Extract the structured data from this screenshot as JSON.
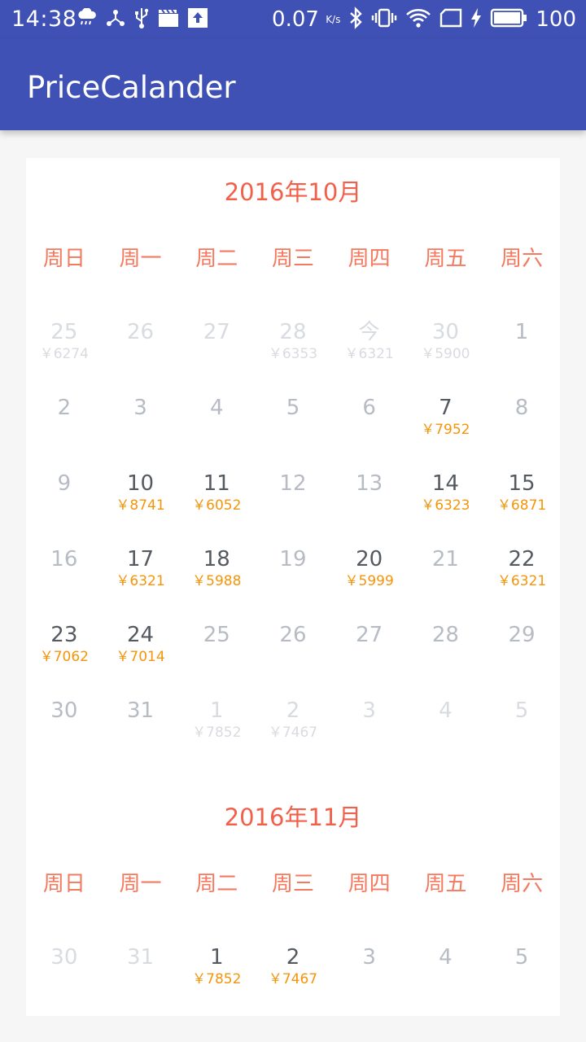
{
  "status_bar": {
    "time": "14:38",
    "net_speed": "0.07",
    "net_speed_unit": "K/s",
    "battery": "100",
    "icons_left": [
      "weather-icon",
      "share-icon",
      "usb-icon",
      "clapper-icon",
      "upload-icon"
    ],
    "icons_right": [
      "bluetooth-icon",
      "vibrate-icon",
      "wifi-icon",
      "sim-icon",
      "charging-icon",
      "battery-icon"
    ]
  },
  "app_bar": {
    "title": "PriceCalander"
  },
  "months": [
    {
      "title": "2016年10月",
      "weekdays": [
        "周日",
        "周一",
        "周二",
        "周三",
        "周四",
        "周五",
        "周六"
      ],
      "days": [
        {
          "num": "25",
          "price": "￥6274",
          "state": "faded"
        },
        {
          "num": "26",
          "price": "",
          "state": "faded"
        },
        {
          "num": "27",
          "price": "",
          "state": "faded"
        },
        {
          "num": "28",
          "price": "￥6353",
          "state": "faded"
        },
        {
          "num": "今",
          "price": "￥6321",
          "state": "faded"
        },
        {
          "num": "30",
          "price": "￥5900",
          "state": "faded"
        },
        {
          "num": "1",
          "price": "",
          "state": "mid"
        },
        {
          "num": "2",
          "price": "",
          "state": "mid"
        },
        {
          "num": "3",
          "price": "",
          "state": "mid"
        },
        {
          "num": "4",
          "price": "",
          "state": "mid"
        },
        {
          "num": "5",
          "price": "",
          "state": "mid"
        },
        {
          "num": "6",
          "price": "",
          "state": "mid"
        },
        {
          "num": "7",
          "price": "￥7952",
          "state": "active"
        },
        {
          "num": "8",
          "price": "",
          "state": "mid"
        },
        {
          "num": "9",
          "price": "",
          "state": "mid"
        },
        {
          "num": "10",
          "price": "￥8741",
          "state": "active"
        },
        {
          "num": "11",
          "price": "￥6052",
          "state": "active"
        },
        {
          "num": "12",
          "price": "",
          "state": "mid"
        },
        {
          "num": "13",
          "price": "",
          "state": "mid"
        },
        {
          "num": "14",
          "price": "￥6323",
          "state": "active"
        },
        {
          "num": "15",
          "price": "￥6871",
          "state": "active"
        },
        {
          "num": "16",
          "price": "",
          "state": "mid"
        },
        {
          "num": "17",
          "price": "￥6321",
          "state": "active"
        },
        {
          "num": "18",
          "price": "￥5988",
          "state": "active"
        },
        {
          "num": "19",
          "price": "",
          "state": "mid"
        },
        {
          "num": "20",
          "price": "￥5999",
          "state": "active"
        },
        {
          "num": "21",
          "price": "",
          "state": "mid"
        },
        {
          "num": "22",
          "price": "￥6321",
          "state": "active"
        },
        {
          "num": "23",
          "price": "￥7062",
          "state": "active"
        },
        {
          "num": "24",
          "price": "￥7014",
          "state": "active"
        },
        {
          "num": "25",
          "price": "",
          "state": "mid"
        },
        {
          "num": "26",
          "price": "",
          "state": "mid"
        },
        {
          "num": "27",
          "price": "",
          "state": "mid"
        },
        {
          "num": "28",
          "price": "",
          "state": "mid"
        },
        {
          "num": "29",
          "price": "",
          "state": "mid"
        },
        {
          "num": "30",
          "price": "",
          "state": "mid"
        },
        {
          "num": "31",
          "price": "",
          "state": "mid"
        },
        {
          "num": "1",
          "price": "￥7852",
          "state": "faded"
        },
        {
          "num": "2",
          "price": "￥7467",
          "state": "faded"
        },
        {
          "num": "3",
          "price": "",
          "state": "faded"
        },
        {
          "num": "4",
          "price": "",
          "state": "faded"
        },
        {
          "num": "5",
          "price": "",
          "state": "faded"
        }
      ]
    },
    {
      "title": "2016年11月",
      "weekdays": [
        "周日",
        "周一",
        "周二",
        "周三",
        "周四",
        "周五",
        "周六"
      ],
      "days": [
        {
          "num": "30",
          "price": "",
          "state": "faded"
        },
        {
          "num": "31",
          "price": "",
          "state": "faded"
        },
        {
          "num": "1",
          "price": "￥7852",
          "state": "active"
        },
        {
          "num": "2",
          "price": "￥7467",
          "state": "active"
        },
        {
          "num": "3",
          "price": "",
          "state": "mid"
        },
        {
          "num": "4",
          "price": "",
          "state": "mid"
        },
        {
          "num": "5",
          "price": "",
          "state": "mid"
        }
      ]
    }
  ]
}
